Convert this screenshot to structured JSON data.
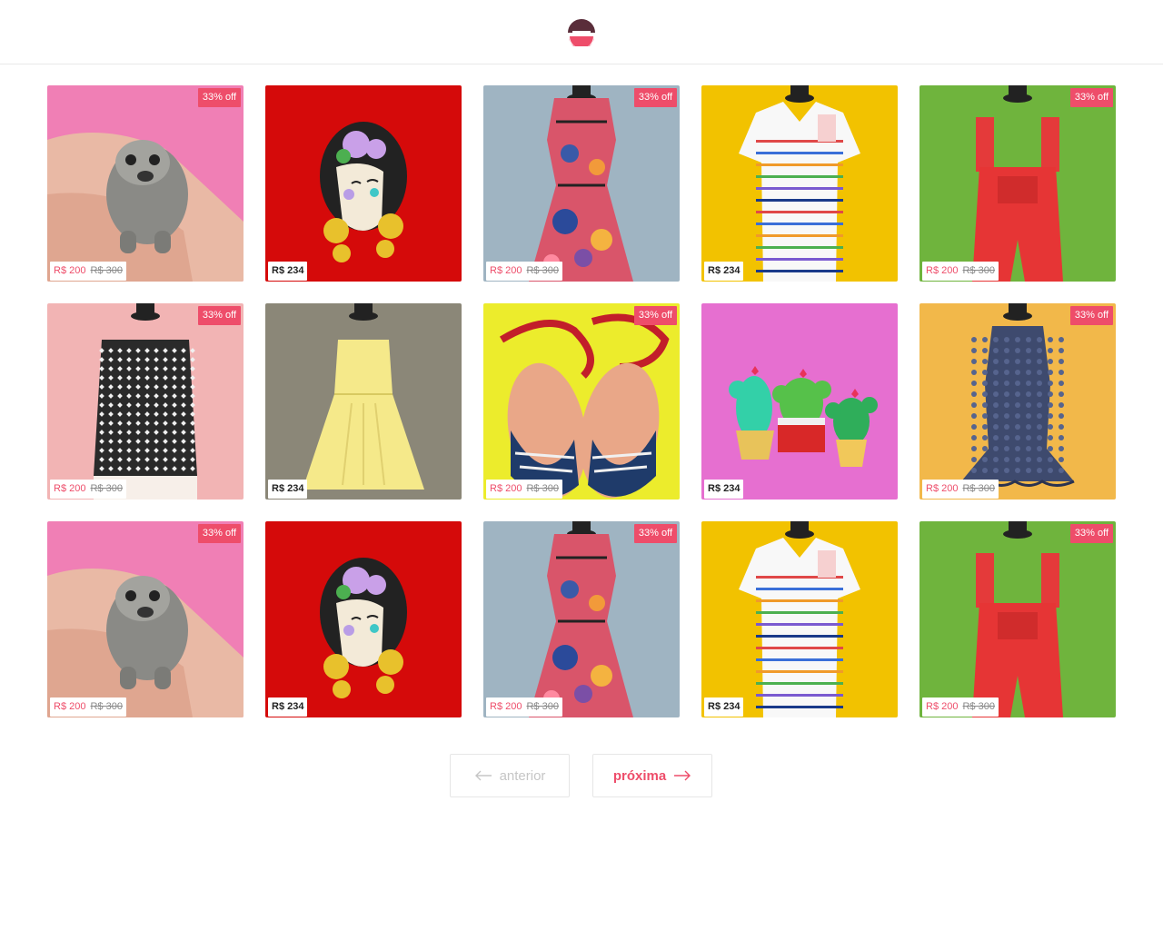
{
  "header": {
    "logo_icon": "e-logo-icon"
  },
  "products": [
    {
      "art": "ring",
      "bg": "#f07fb5",
      "discount": "33% off",
      "price": "R$ 200",
      "old_price": "R$ 300"
    },
    {
      "art": "frida",
      "bg": "#d50a0a",
      "discount": "",
      "price": "R$ 234",
      "old_price": ""
    },
    {
      "art": "dress_print",
      "bg": "#9fb4c2",
      "discount": "33% off",
      "price": "R$ 200",
      "old_price": "R$ 300"
    },
    {
      "art": "polo",
      "bg": "#f2c200",
      "discount": "",
      "price": "R$ 234",
      "old_price": ""
    },
    {
      "art": "overall",
      "bg": "#6fb43d",
      "discount": "33% off",
      "price": "R$ 200",
      "old_price": "R$ 300"
    },
    {
      "art": "crop_top",
      "bg": "#f2b4b4",
      "discount": "33% off",
      "price": "R$ 200",
      "old_price": "R$ 300"
    },
    {
      "art": "yellow_dress",
      "bg": "#8b8778",
      "discount": "",
      "price": "R$ 234",
      "old_price": ""
    },
    {
      "art": "sandals",
      "bg": "#ecec2c",
      "discount": "33% off",
      "price": "R$ 200",
      "old_price": "R$ 300"
    },
    {
      "art": "cactus",
      "bg": "#e66fd0",
      "discount": "",
      "price": "R$ 234",
      "old_price": ""
    },
    {
      "art": "lace_dress",
      "bg": "#f2b84a",
      "discount": "33% off",
      "price": "R$ 200",
      "old_price": "R$ 300"
    },
    {
      "art": "ring",
      "bg": "#f07fb5",
      "discount": "33% off",
      "price": "R$ 200",
      "old_price": "R$ 300"
    },
    {
      "art": "frida",
      "bg": "#d50a0a",
      "discount": "",
      "price": "R$ 234",
      "old_price": ""
    },
    {
      "art": "dress_print",
      "bg": "#9fb4c2",
      "discount": "33% off",
      "price": "R$ 200",
      "old_price": "R$ 300"
    },
    {
      "art": "polo",
      "bg": "#f2c200",
      "discount": "",
      "price": "R$ 234",
      "old_price": ""
    },
    {
      "art": "overall",
      "bg": "#6fb43d",
      "discount": "33% off",
      "price": "R$ 200",
      "old_price": "R$ 300"
    }
  ],
  "pagination": {
    "prev_label": "anterior",
    "next_label": "próxima"
  },
  "colors": {
    "accent": "#ee4d6a",
    "brand_dark": "#5a2d3a",
    "border": "#e8e8e8"
  }
}
